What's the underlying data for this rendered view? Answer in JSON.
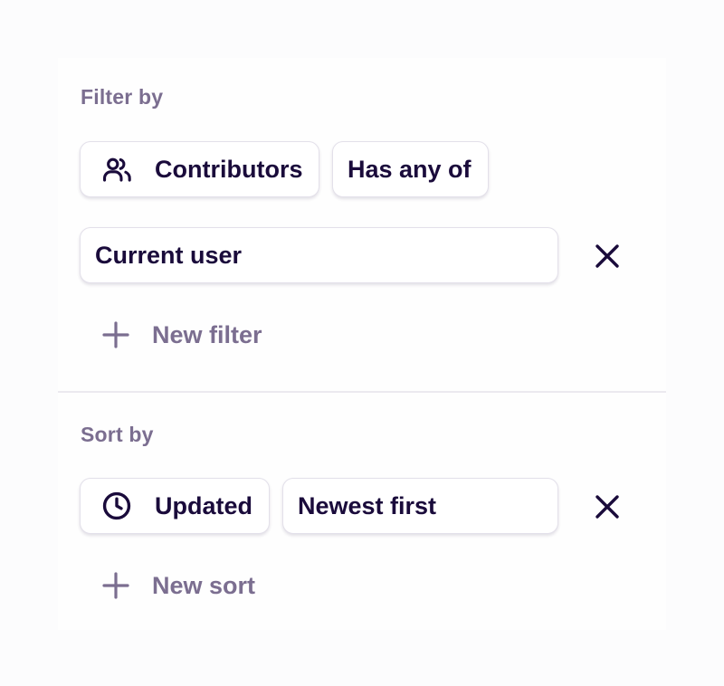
{
  "filter": {
    "section_label": "Filter by",
    "field_chip": {
      "icon": "users-icon",
      "label": "Contributors"
    },
    "operator_chip": {
      "label": "Has any of"
    },
    "value_chip": {
      "label": "Current user"
    },
    "remove_icon": "close-icon",
    "add_label": "New filter"
  },
  "sort": {
    "section_label": "Sort by",
    "field_chip": {
      "icon": "clock-icon",
      "label": "Updated"
    },
    "order_chip": {
      "label": "Newest first"
    },
    "remove_icon": "close-icon",
    "add_label": "New sort"
  },
  "colors": {
    "primary_text": "#1a0b3b",
    "muted_text": "#7b6e90",
    "chip_border": "#e3e0ea",
    "divider": "#ebe9ef"
  }
}
